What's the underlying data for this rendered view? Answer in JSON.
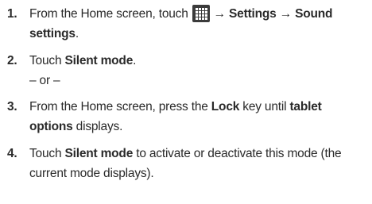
{
  "steps": [
    {
      "number": "1.",
      "line1_pre": "From the Home screen, touch",
      "line1_post": "→ Settings → Sound",
      "line2": "settings",
      "line2_end": ".",
      "icon": "apps-grid-icon"
    },
    {
      "number": "2.",
      "pre": "Touch ",
      "bold": "Silent mode",
      "post": ".",
      "or_text": "– or –"
    },
    {
      "number": "3.",
      "line1_pre": "From the Home screen, press the ",
      "line1_bold": "Lock",
      "line1_mid": " key until ",
      "line1_bold2": "tablet",
      "line2_bold": "options",
      "line2_post": " displays."
    },
    {
      "number": "4.",
      "line1_pre": "Touch ",
      "line1_bold": "Silent mode",
      "line1_post": " to activate or deactivate this mode (the",
      "line2": "current mode displays)."
    }
  ]
}
